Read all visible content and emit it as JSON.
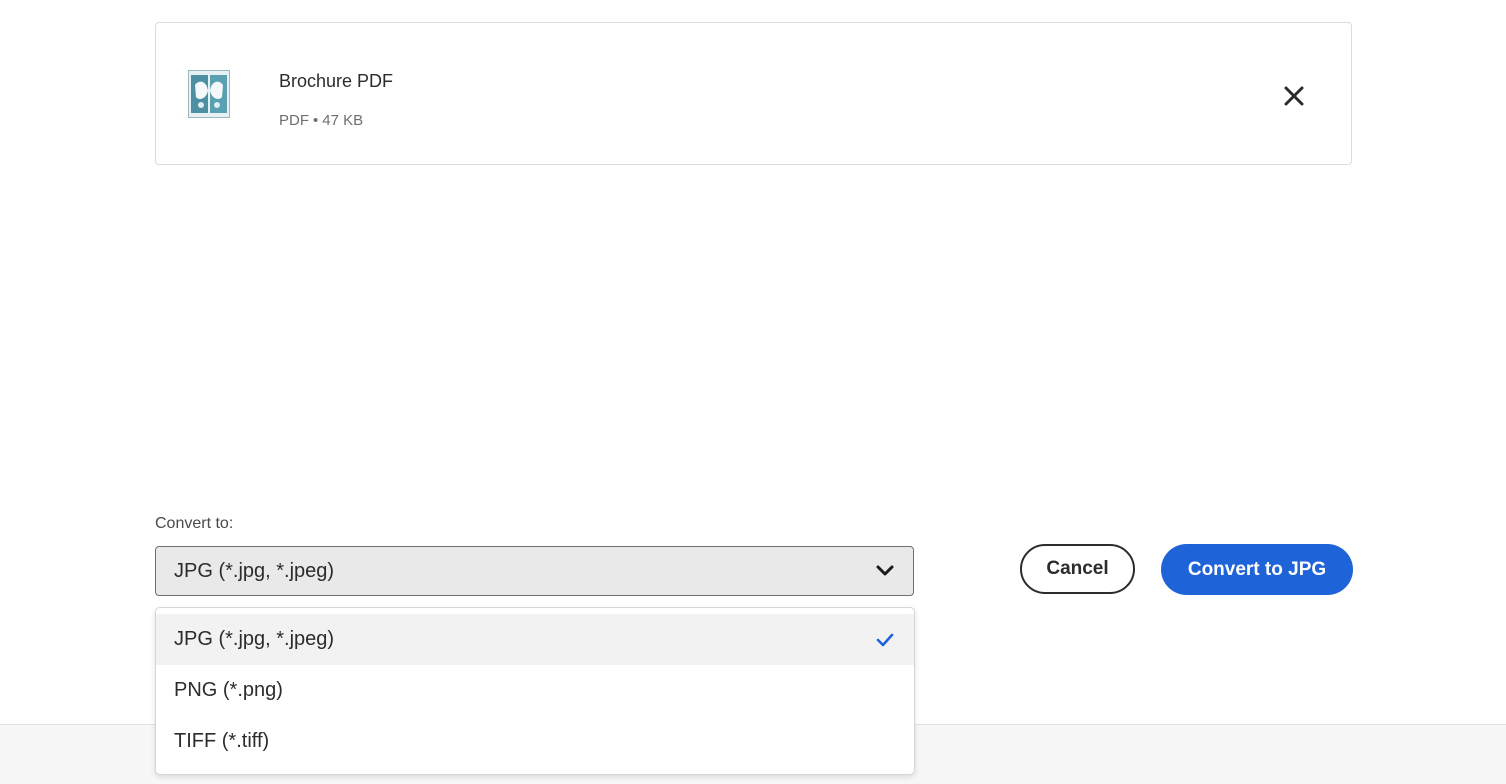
{
  "file": {
    "name": "Brochure PDF",
    "type": "PDF",
    "separator": "•",
    "size": "47 KB",
    "thumbnail_icon": "pdf-thumbnail-icon"
  },
  "convert": {
    "label": "Convert to:",
    "selected": "JPG (*.jpg, *.jpeg)",
    "options": [
      {
        "label": "JPG (*.jpg, *.jpeg)",
        "selected": true
      },
      {
        "label": "PNG (*.png)",
        "selected": false
      },
      {
        "label": "TIFF (*.tiff)",
        "selected": false
      }
    ]
  },
  "actions": {
    "cancel_label": "Cancel",
    "convert_label": "Convert to JPG"
  },
  "colors": {
    "accent": "#1f63d9",
    "check": "#1f63d9"
  }
}
